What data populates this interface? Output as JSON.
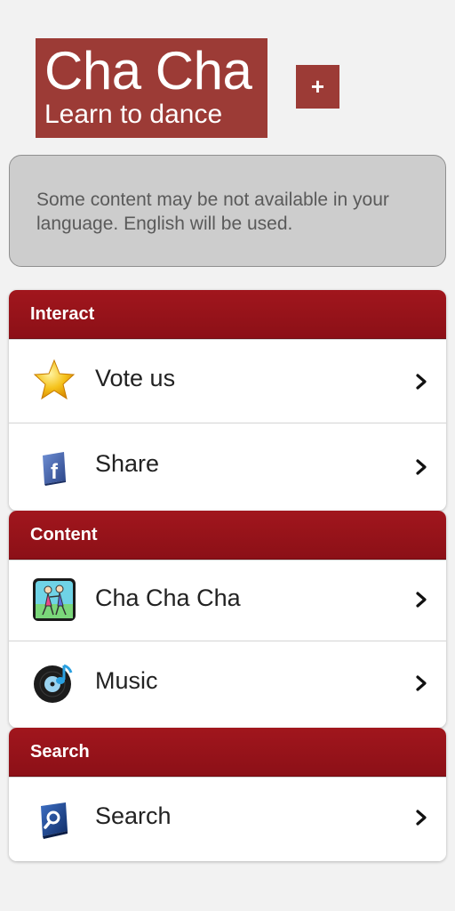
{
  "header": {
    "logo_title": "Cha Cha",
    "logo_subtitle": "Learn to dance",
    "add_button_label": "+"
  },
  "notice": {
    "text": "Some content may be not available in your language. English will be used."
  },
  "sections": [
    {
      "title": "Interact",
      "items": [
        {
          "label": "Vote us",
          "icon": "star-icon"
        },
        {
          "label": "Share",
          "icon": "facebook-icon"
        }
      ]
    },
    {
      "title": "Content",
      "items": [
        {
          "label": "Cha Cha Cha",
          "icon": "dancers-icon"
        },
        {
          "label": "Music",
          "icon": "music-disc-icon"
        }
      ]
    },
    {
      "title": "Search",
      "items": [
        {
          "label": "Search",
          "icon": "search-icon"
        }
      ]
    }
  ],
  "colors": {
    "brand": "#9c3b36",
    "section_header": "#9a141b",
    "background": "#f2f2f2",
    "notice_bg": "#cdcdcd"
  }
}
